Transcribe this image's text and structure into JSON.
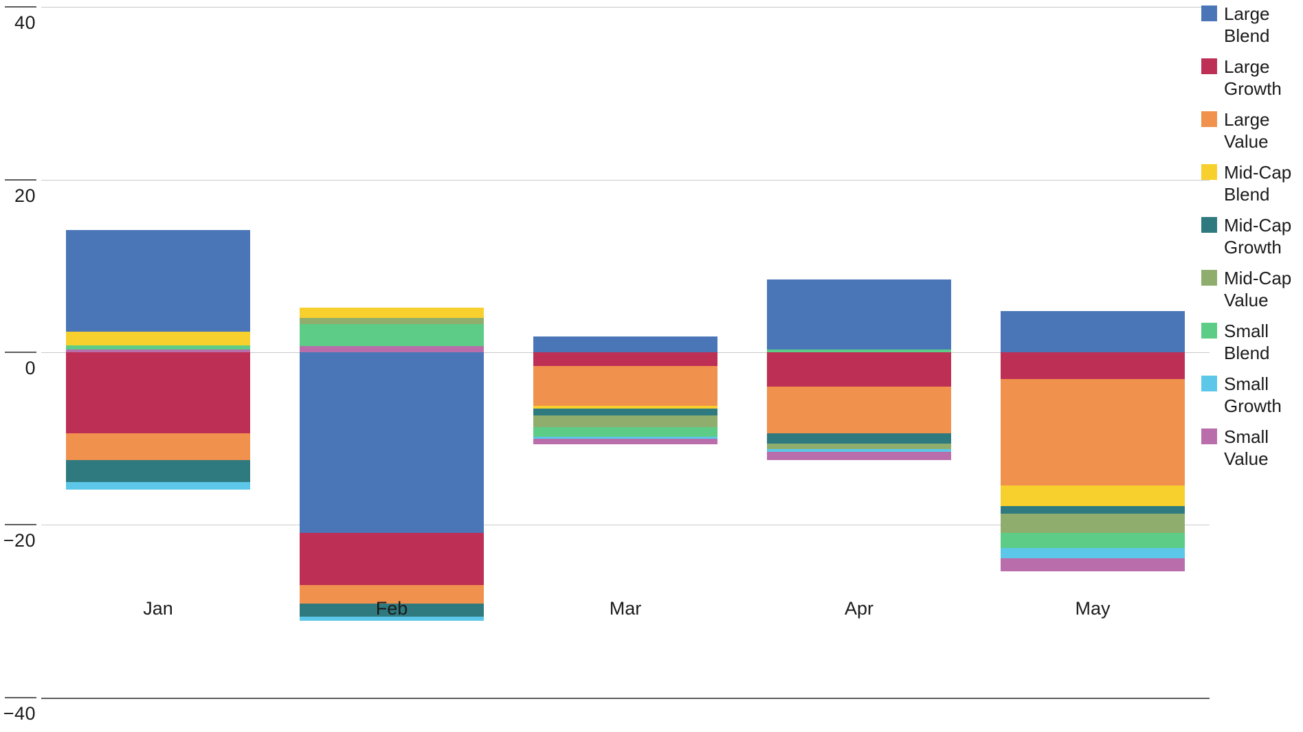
{
  "chart_data": {
    "type": "bar",
    "subtype": "stacked-diverging",
    "title": "",
    "subtitle": "",
    "xlabel": "",
    "ylabel": "",
    "categories": [
      "Jan",
      "Feb",
      "Mar",
      "Apr",
      "May"
    ],
    "ylim": [
      -40,
      40
    ],
    "yticks": [
      40,
      20,
      0,
      -20,
      -40
    ],
    "ytick_labels": [
      "40",
      "20",
      "0",
      "−20",
      "−40"
    ],
    "grid": true,
    "legend_position": "right",
    "series": [
      {
        "name": "Large Blend",
        "color": "#4a76b8",
        "values": [
          11.8,
          -20.9,
          1.8,
          8.1,
          4.8
        ]
      },
      {
        "name": "Large Growth",
        "color": "#bd2f55",
        "values": [
          -9.4,
          -6.1,
          -1.6,
          -4.0,
          -3.1
        ]
      },
      {
        "name": "Large Value",
        "color": "#f0914e",
        "values": [
          -3.1,
          -2.1,
          -4.6,
          -5.4,
          -12.3
        ]
      },
      {
        "name": "Mid-Cap Blend",
        "color": "#f8d02e",
        "values": [
          1.6,
          1.2,
          -0.3,
          -0.2,
          -2.4
        ]
      },
      {
        "name": "Mid-Cap Growth",
        "color": "#2f7a7f",
        "values": [
          -2.5,
          -1.5,
          -0.8,
          -1.2,
          -0.9
        ]
      },
      {
        "name": "Mid-Cap Value",
        "color": "#8fae6e",
        "values": [
          0.0,
          0.7,
          -1.4,
          -0.6,
          -2.2
        ]
      },
      {
        "name": "Small Blend",
        "color": "#5ccc86",
        "values": [
          0.5,
          2.6,
          -1.1,
          0.3,
          -1.8
        ]
      },
      {
        "name": "Small Growth",
        "color": "#5cc7e8",
        "values": [
          -0.9,
          -0.5,
          -0.2,
          -0.3,
          -1.2
        ]
      },
      {
        "name": "Small Value",
        "color": "#b96eab",
        "values": [
          0.0,
          2.4,
          -0.7,
          -1.0,
          -1.5
        ]
      }
    ],
    "bars": [
      {
        "category": "Jan",
        "positive": [
          {
            "series": "Large Blend",
            "value": 11.8
          },
          {
            "series": "Mid-Cap Blend",
            "value": 1.6
          },
          {
            "series": "Small Blend",
            "value": 0.5
          },
          {
            "series": "Small Value",
            "value": 0.3
          }
        ],
        "negative": [
          {
            "series": "Large Growth",
            "value": -9.4
          },
          {
            "series": "Large Value",
            "value": -3.1
          },
          {
            "series": "Mid-Cap Growth",
            "value": -2.5
          },
          {
            "series": "Small Growth",
            "value": -0.9
          }
        ]
      },
      {
        "category": "Feb",
        "positive": [
          {
            "series": "Mid-Cap Blend",
            "value": 1.2
          },
          {
            "series": "Mid-Cap Value",
            "value": 0.7
          },
          {
            "series": "Small Blend",
            "value": 2.6
          },
          {
            "series": "Small Value",
            "value": 0.7
          }
        ],
        "negative": [
          {
            "series": "Large Blend",
            "value": -20.9
          },
          {
            "series": "Large Growth",
            "value": -6.1
          },
          {
            "series": "Large Value",
            "value": -2.1
          },
          {
            "series": "Mid-Cap Growth",
            "value": -1.5
          },
          {
            "series": "Small Growth",
            "value": -0.5
          }
        ]
      },
      {
        "category": "Mar",
        "positive": [
          {
            "series": "Large Blend",
            "value": 1.8
          }
        ],
        "negative": [
          {
            "series": "Large Growth",
            "value": -1.6
          },
          {
            "series": "Large Value",
            "value": -4.6
          },
          {
            "series": "Mid-Cap Blend",
            "value": -0.3
          },
          {
            "series": "Mid-Cap Growth",
            "value": -0.8
          },
          {
            "series": "Mid-Cap Value",
            "value": -1.4
          },
          {
            "series": "Small Blend",
            "value": -1.1
          },
          {
            "series": "Small Growth",
            "value": -0.2
          },
          {
            "series": "Small Value",
            "value": -0.7
          }
        ]
      },
      {
        "category": "Apr",
        "positive": [
          {
            "series": "Large Blend",
            "value": 8.1
          },
          {
            "series": "Small Blend",
            "value": 0.3
          }
        ],
        "negative": [
          {
            "series": "Large Growth",
            "value": -4.0
          },
          {
            "series": "Large Value",
            "value": -5.4
          },
          {
            "series": "Mid-Cap Growth",
            "value": -1.2
          },
          {
            "series": "Mid-Cap Value",
            "value": -0.6
          },
          {
            "series": "Small Growth",
            "value": -0.3
          },
          {
            "series": "Small Value",
            "value": -1.0
          }
        ]
      },
      {
        "category": "May",
        "positive": [
          {
            "series": "Large Blend",
            "value": 4.8
          }
        ],
        "negative": [
          {
            "series": "Large Growth",
            "value": -3.1
          },
          {
            "series": "Large Value",
            "value": -12.3
          },
          {
            "series": "Mid-Cap Blend",
            "value": -2.4
          },
          {
            "series": "Mid-Cap Growth",
            "value": -0.9
          },
          {
            "series": "Mid-Cap Value",
            "value": -2.2
          },
          {
            "series": "Small Blend",
            "value": -1.8
          },
          {
            "series": "Small Growth",
            "value": -1.2
          },
          {
            "series": "Small Value",
            "value": -1.5
          }
        ]
      }
    ]
  },
  "legend": {
    "items": [
      {
        "label": "Large\nBlend",
        "color": "#4a76b8",
        "name": "large-blend"
      },
      {
        "label": "Large\nGrowth",
        "color": "#bd2f55",
        "name": "large-growth"
      },
      {
        "label": "Large\nValue",
        "color": "#f0914e",
        "name": "large-value"
      },
      {
        "label": "Mid-Cap\nBlend",
        "color": "#f8d02e",
        "name": "mid-cap-blend"
      },
      {
        "label": "Mid-Cap\nGrowth",
        "color": "#2f7a7f",
        "name": "mid-cap-growth"
      },
      {
        "label": "Mid-Cap\nValue",
        "color": "#8fae6e",
        "name": "mid-cap-value"
      },
      {
        "label": "Small\nBlend",
        "color": "#5ccc86",
        "name": "small-blend"
      },
      {
        "label": "Small\nGrowth",
        "color": "#5cc7e8",
        "name": "small-growth"
      },
      {
        "label": "Small\nValue",
        "color": "#b96eab",
        "name": "small-value"
      }
    ]
  }
}
